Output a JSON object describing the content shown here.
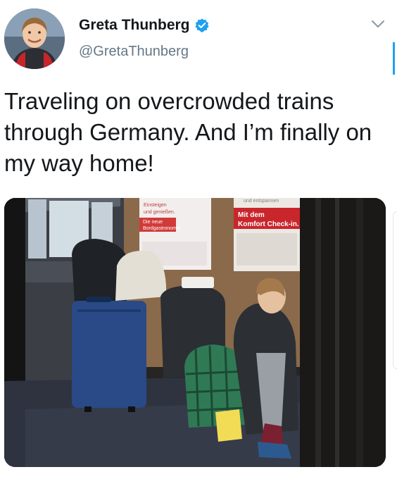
{
  "author": {
    "display_name": "Greta Thunberg",
    "handle": "@GretaThunberg",
    "verified": true,
    "verified_icon": "verified-badge-icon",
    "accent_color": "#1da1f2"
  },
  "menu": {
    "icon": "chevron-down-icon"
  },
  "tweet": {
    "text": "Traveling on overcrowded trains through Germany. And I’m finally on my way home!"
  },
  "photo": {
    "poster_left": {
      "line1": "Einsteigen",
      "line2": "und genießen.",
      "line3": "Die neue",
      "line4": "Bordgastronomie."
    },
    "poster_right": {
      "top": "und entspannen",
      "line1": "Mit dem",
      "line2": "Komfort Check-in."
    }
  }
}
